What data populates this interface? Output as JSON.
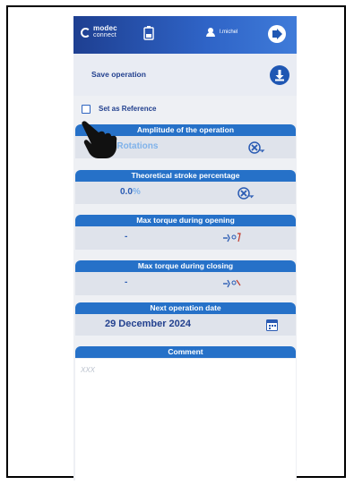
{
  "header": {
    "brand_line1": "modec",
    "brand_line2": "connect",
    "username": "l.michel",
    "logout_icon": "logout-icon",
    "battery_icon": "battery-icon"
  },
  "save": {
    "label": "Save operation",
    "icon": "download-icon"
  },
  "reference": {
    "label": "Set as Reference",
    "checked": false
  },
  "cards": {
    "amplitude": {
      "title": "Amplitude of the operation",
      "value": ".0",
      "unit": "Rotations",
      "icon": "rotation-icon"
    },
    "stroke": {
      "title": "Theoretical stroke percentage",
      "value": "0.0",
      "unit": "%",
      "icon": "rotation-icon"
    },
    "opening": {
      "title": "Max torque during opening",
      "value": "-",
      "icon": "torque-open-icon"
    },
    "closing": {
      "title": "Max torque during closing",
      "value": "-",
      "icon": "torque-close-icon"
    },
    "next_date": {
      "title": "Next operation date",
      "value": "29 December 2024",
      "icon": "calendar-icon"
    }
  },
  "comment": {
    "title": "Comment",
    "placeholder": "XXX"
  },
  "colors": {
    "header_blue": "#1e3f91",
    "card_blue": "#2671c8",
    "text_blue": "#23418f",
    "unit_light_blue": "#7fb2ea"
  }
}
